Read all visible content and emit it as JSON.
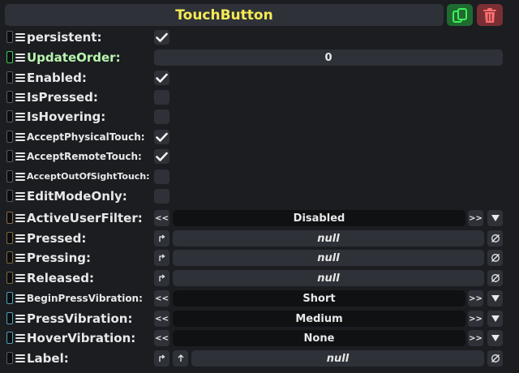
{
  "header": {
    "title": "TouchButton"
  },
  "rows": [
    {
      "label": "persistent:",
      "checked": true
    },
    {
      "label": "UpdateOrder:",
      "value": "0"
    },
    {
      "label": "Enabled:",
      "checked": true
    },
    {
      "label": "IsPressed:",
      "checked": false
    },
    {
      "label": "IsHovering:",
      "checked": false
    },
    {
      "label": "AcceptPhysicalTouch:",
      "checked": true
    },
    {
      "label": "AcceptRemoteTouch:",
      "checked": true
    },
    {
      "label": "AcceptOutOfSightTouch:",
      "checked": false
    },
    {
      "label": "EditModeOnly:",
      "checked": false
    },
    {
      "label": "ActiveUserFilter:",
      "value": "Disabled"
    },
    {
      "label": "Pressed:",
      "value": "null"
    },
    {
      "label": "Pressing:",
      "value": "null"
    },
    {
      "label": "Released:",
      "value": "null"
    },
    {
      "label": "BeginPressVibration:",
      "value": "Short"
    },
    {
      "label": "PressVibration:",
      "value": "Medium"
    },
    {
      "label": "HoverVibration:",
      "value": "None"
    },
    {
      "label": "Label:",
      "value": "null"
    }
  ],
  "buttons": {
    "prev": "<<",
    "next": ">>"
  },
  "colors": {
    "background": "#1b1d21",
    "panel": "#2e3238",
    "title": "#f6ea55",
    "update_order_label": "#b8f5ad",
    "copy_button": "#1f6a31",
    "delete_button": "#7a2f34"
  }
}
